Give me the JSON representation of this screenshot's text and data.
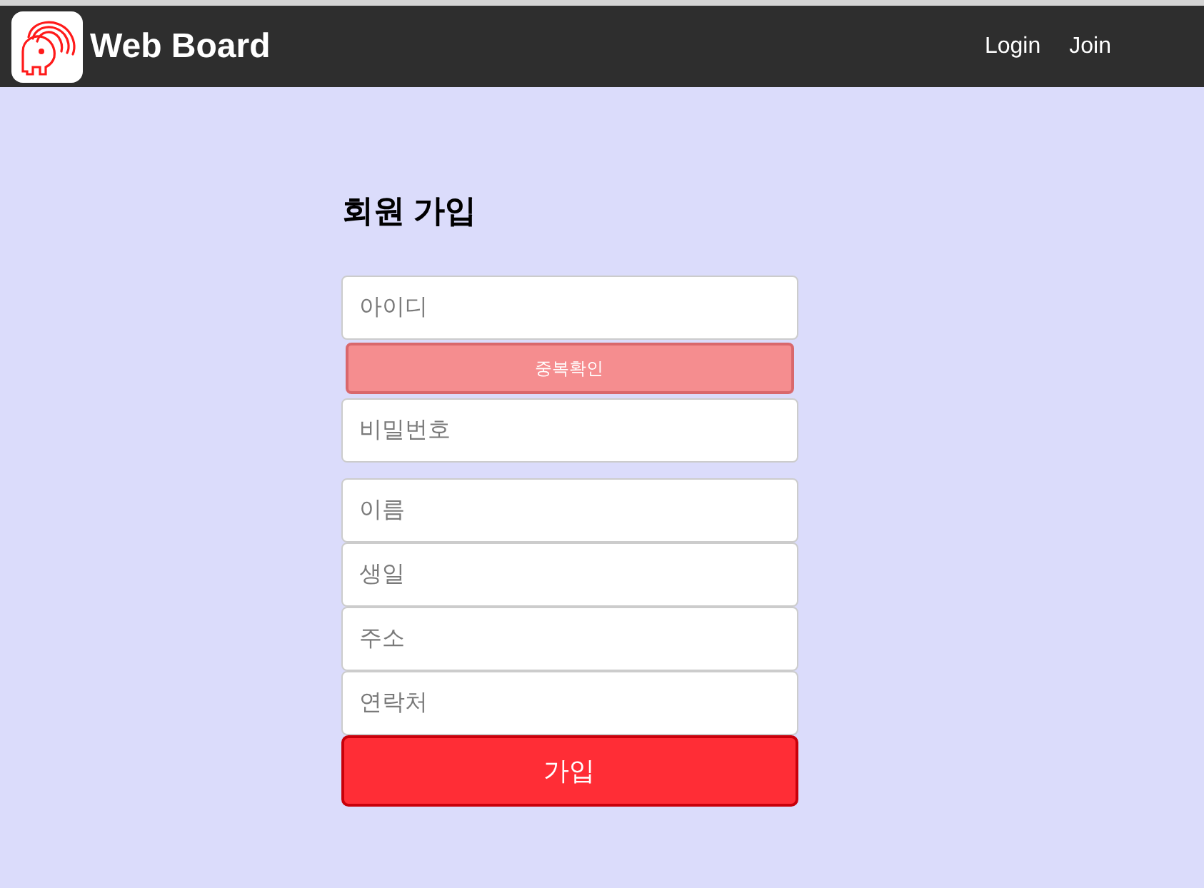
{
  "navbar": {
    "brand": "Web Board",
    "links": [
      {
        "label": "Login"
      },
      {
        "label": "Join"
      }
    ]
  },
  "form": {
    "title": "회원 가입",
    "id_field": {
      "placeholder": "아이디"
    },
    "check_button": {
      "label": "중복확인"
    },
    "password_field": {
      "placeholder": "비밀번호"
    },
    "profile_fields": [
      {
        "placeholder": "이름"
      },
      {
        "placeholder": "생일"
      },
      {
        "placeholder": "주소"
      },
      {
        "placeholder": "연락처"
      }
    ],
    "submit_button": {
      "label": "가입"
    }
  }
}
